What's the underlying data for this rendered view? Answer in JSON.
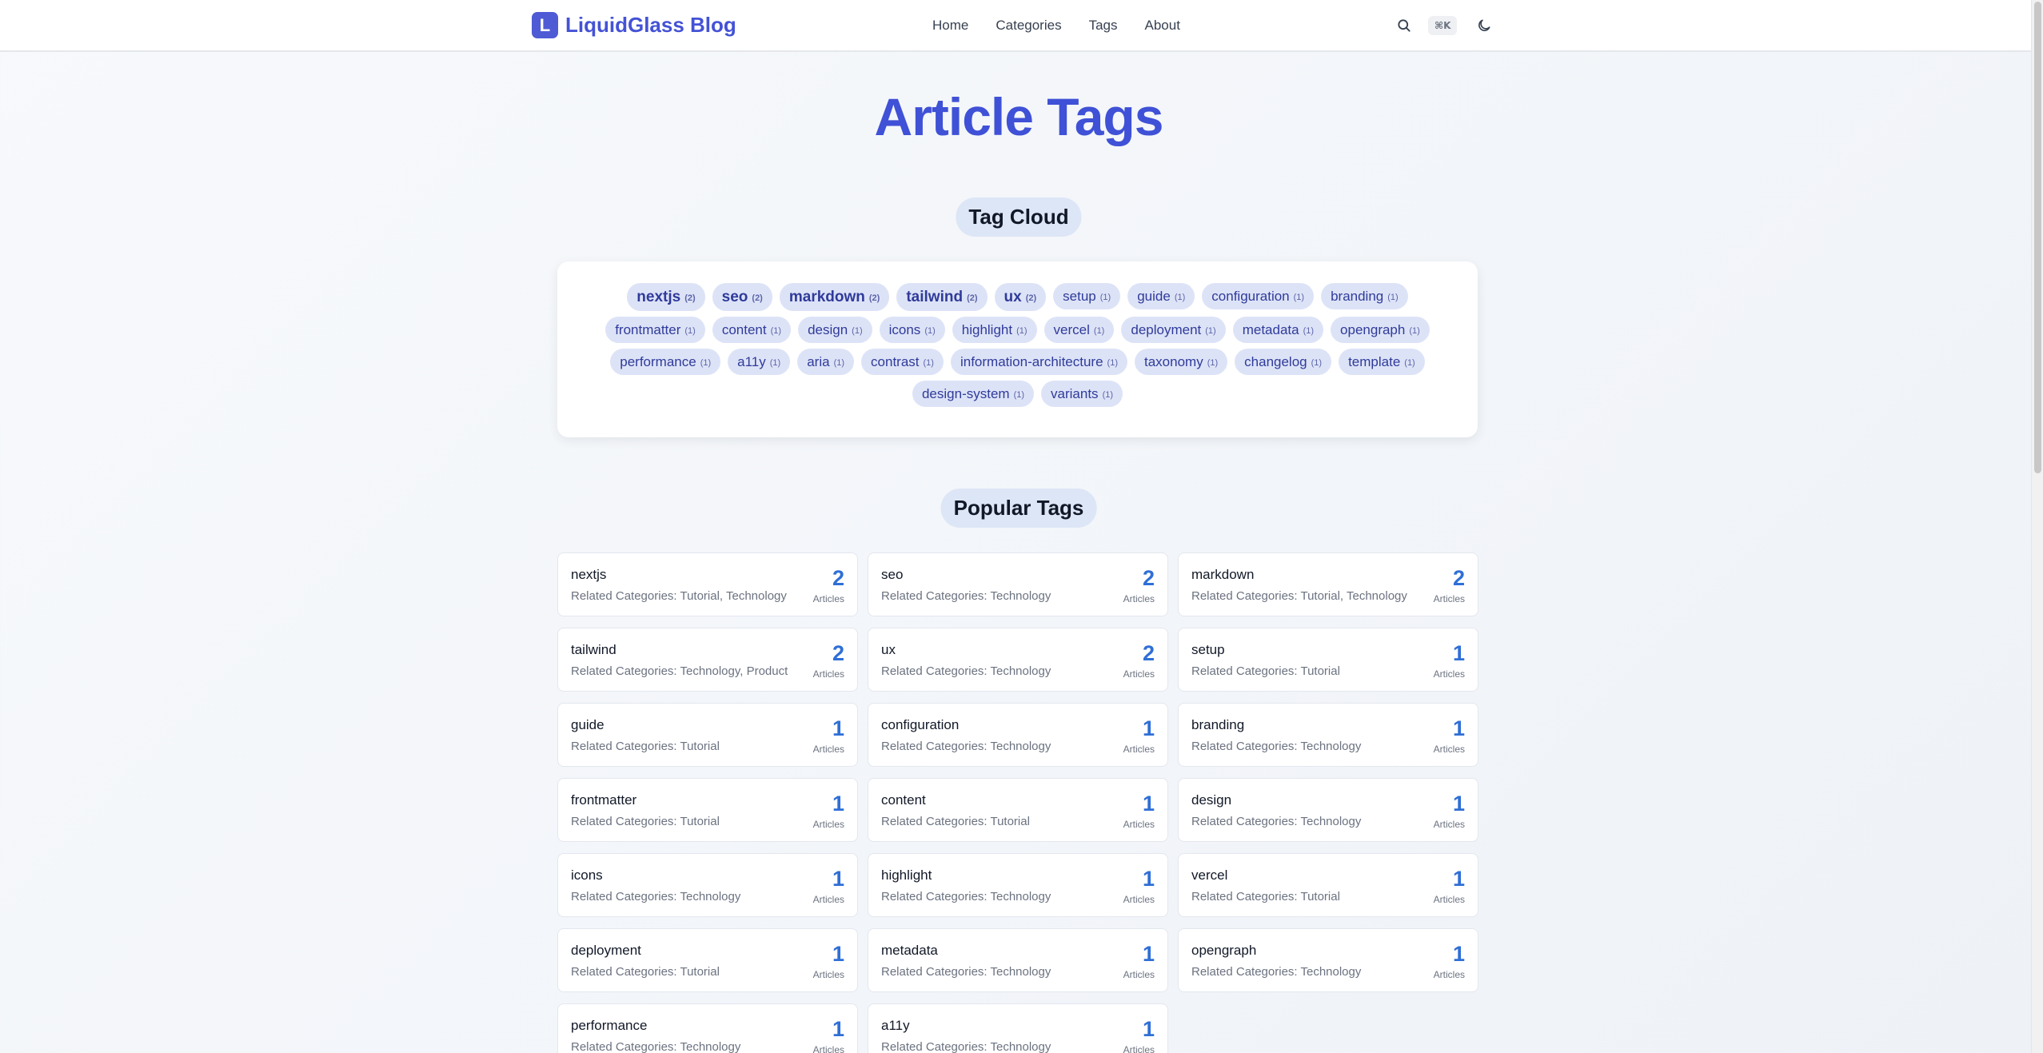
{
  "header": {
    "logo_letter": "L",
    "brand": "LiquidGlass Blog",
    "nav": [
      "Home",
      "Categories",
      "Tags",
      "About"
    ],
    "shortcut": "⌘K"
  },
  "page": {
    "title": "Article Tags",
    "cloud_title": "Tag Cloud",
    "popular_title": "Popular Tags",
    "articles_label": "Articles",
    "related_prefix": "Related Categories: "
  },
  "tags": [
    {
      "name": "nextjs",
      "count": "(2)"
    },
    {
      "name": "seo",
      "count": "(2)"
    },
    {
      "name": "markdown",
      "count": "(2)"
    },
    {
      "name": "tailwind",
      "count": "(2)"
    },
    {
      "name": "ux",
      "count": "(2)"
    },
    {
      "name": "setup",
      "count": "(1)"
    },
    {
      "name": "guide",
      "count": "(1)"
    },
    {
      "name": "configuration",
      "count": "(1)"
    },
    {
      "name": "branding",
      "count": "(1)"
    },
    {
      "name": "frontmatter",
      "count": "(1)"
    },
    {
      "name": "content",
      "count": "(1)"
    },
    {
      "name": "design",
      "count": "(1)"
    },
    {
      "name": "icons",
      "count": "(1)"
    },
    {
      "name": "highlight",
      "count": "(1)"
    },
    {
      "name": "vercel",
      "count": "(1)"
    },
    {
      "name": "deployment",
      "count": "(1)"
    },
    {
      "name": "metadata",
      "count": "(1)"
    },
    {
      "name": "opengraph",
      "count": "(1)"
    },
    {
      "name": "performance",
      "count": "(1)"
    },
    {
      "name": "a11y",
      "count": "(1)"
    },
    {
      "name": "aria",
      "count": "(1)"
    },
    {
      "name": "contrast",
      "count": "(1)"
    },
    {
      "name": "information-architecture",
      "count": "(1)"
    },
    {
      "name": "taxonomy",
      "count": "(1)"
    },
    {
      "name": "changelog",
      "count": "(1)"
    },
    {
      "name": "template",
      "count": "(1)"
    },
    {
      "name": "design-system",
      "count": "(1)"
    },
    {
      "name": "variants",
      "count": "(1)"
    }
  ],
  "popular": [
    {
      "name": "nextjs",
      "cats": "Related Categories: Tutorial, Technology",
      "count": "2"
    },
    {
      "name": "seo",
      "cats": "Related Categories: Technology",
      "count": "2"
    },
    {
      "name": "markdown",
      "cats": "Related Categories: Tutorial, Technology",
      "count": "2"
    },
    {
      "name": "tailwind",
      "cats": "Related Categories: Technology, Product",
      "count": "2"
    },
    {
      "name": "ux",
      "cats": "Related Categories: Technology",
      "count": "2"
    },
    {
      "name": "setup",
      "cats": "Related Categories: Tutorial",
      "count": "1"
    },
    {
      "name": "guide",
      "cats": "Related Categories: Tutorial",
      "count": "1"
    },
    {
      "name": "configuration",
      "cats": "Related Categories: Technology",
      "count": "1"
    },
    {
      "name": "branding",
      "cats": "Related Categories: Technology",
      "count": "1"
    },
    {
      "name": "frontmatter",
      "cats": "Related Categories: Tutorial",
      "count": "1"
    },
    {
      "name": "content",
      "cats": "Related Categories: Tutorial",
      "count": "1"
    },
    {
      "name": "design",
      "cats": "Related Categories: Technology",
      "count": "1"
    },
    {
      "name": "icons",
      "cats": "Related Categories: Technology",
      "count": "1"
    },
    {
      "name": "highlight",
      "cats": "Related Categories: Technology",
      "count": "1"
    },
    {
      "name": "vercel",
      "cats": "Related Categories: Tutorial",
      "count": "1"
    },
    {
      "name": "deployment",
      "cats": "Related Categories: Tutorial",
      "count": "1"
    },
    {
      "name": "metadata",
      "cats": "Related Categories: Technology",
      "count": "1"
    },
    {
      "name": "opengraph",
      "cats": "Related Categories: Technology",
      "count": "1"
    },
    {
      "name": "performance",
      "cats": "Related Categories: Technology",
      "count": "1"
    },
    {
      "name": "a11y",
      "cats": "Related Categories: Technology",
      "count": "1"
    }
  ]
}
